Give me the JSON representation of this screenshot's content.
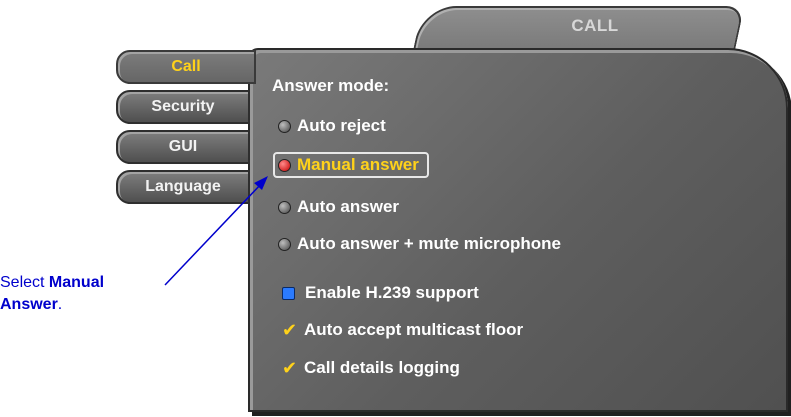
{
  "window": {
    "title": "CALL"
  },
  "tabs": [
    {
      "label": "Call",
      "active": true
    },
    {
      "label": "Security",
      "active": false
    },
    {
      "label": "GUI",
      "active": false
    },
    {
      "label": "Language",
      "active": false
    }
  ],
  "panel": {
    "answer_mode_label": "Answer mode:",
    "options": [
      {
        "label": "Auto reject",
        "selected": false
      },
      {
        "label": "Manual answer",
        "selected": true
      },
      {
        "label": "Auto answer",
        "selected": false
      },
      {
        "label": "Auto answer + mute microphone",
        "selected": false
      }
    ],
    "checkboxes": [
      {
        "label": "Enable H.239 support",
        "checked": false
      },
      {
        "label": "Auto accept multicast floor",
        "checked": true
      },
      {
        "label": "Call details logging",
        "checked": true
      }
    ]
  },
  "annotation": {
    "prefix": "Select ",
    "bold1": "Manual",
    "bold2": "Answer",
    "suffix": "."
  },
  "colors": {
    "highlight_text": "#ffd21a",
    "annotation": "#0000cc",
    "panel": "#6a6a6a"
  }
}
